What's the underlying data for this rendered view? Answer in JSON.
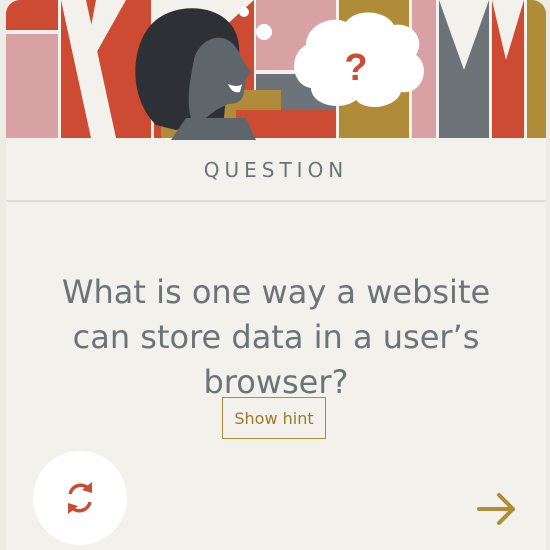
{
  "card": {
    "section_label": "QUESTION",
    "question": "What is one way a website can store data in a user’s browser?",
    "hint_button_label": "Show hint",
    "thought_bubble_symbol": "?"
  },
  "icons": {
    "refresh": "refresh-cycle-icon",
    "next": "arrow-right-icon"
  },
  "colors": {
    "background": "#f3f1ec",
    "text": "#6c7379",
    "accent_gold": "#b08c38",
    "accent_red": "#cd4b33",
    "pink": "#d8a2a5",
    "slate": "#6c747a"
  }
}
